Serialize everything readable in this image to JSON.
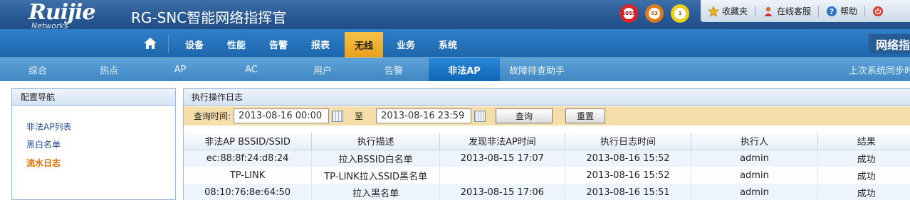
{
  "header": {
    "brand": "Ruijie",
    "brand_sub": "Networks",
    "title": "RG-SNC智能网络指挥官",
    "badges": [
      "1055",
      "53",
      "1"
    ],
    "links": [
      {
        "label": "收藏夹",
        "icon": "star-icon"
      },
      {
        "label": "在线客服",
        "icon": "support-person-icon"
      },
      {
        "label": "帮助",
        "icon": "help-icon"
      }
    ]
  },
  "nav": {
    "items": [
      "设备",
      "性能",
      "告警",
      "报表",
      "无线",
      "业务",
      "系统"
    ],
    "active": "无线",
    "right_label": "网络指挥"
  },
  "subnav": {
    "items": [
      "综合",
      "热点",
      "AP",
      "AC",
      "用户",
      "告警",
      "非法AP",
      "故障排查助手"
    ],
    "active": "非法AP",
    "sync_text": "上次系统同步时"
  },
  "left": {
    "title": "配置导航",
    "links": [
      "非法AP列表",
      "黑白名单",
      "流水日志"
    ],
    "active": "流水日志"
  },
  "main": {
    "title": "执行操作日志",
    "query_label": "查询时间:",
    "start_value": "2013-08-16 00:00",
    "to_label": "至",
    "end_value": "2013-08-16 23:59",
    "query_button": "查询",
    "reset_button": "重置",
    "columns": [
      "非法AP BSSID/SSID",
      "执行描述",
      "发现非法AP时间",
      "执行日志时间",
      "执行人",
      "结果"
    ],
    "rows": [
      [
        "ec:88:8f:24:d8:24",
        "拉入BSSID白名单",
        "2013-08-15 17:07",
        "2013-08-16 15:52",
        "admin",
        "成功"
      ],
      [
        "TP-LINK",
        "TP-LINK拉入SSID黑名单",
        "",
        "2013-08-16 15:52",
        "admin",
        "成功"
      ],
      [
        "08:10:76:8e:64:50",
        "拉入黑名单",
        "2013-08-15 17:06",
        "2013-08-16 15:51",
        "admin",
        "成功"
      ]
    ]
  },
  "colors": {
    "nav_bg": "#1d66ad",
    "nav_active": "#f0b030",
    "subnav_active": "#0f67b8",
    "query_bar": "#f5deaa",
    "active_link": "#d86e00"
  }
}
